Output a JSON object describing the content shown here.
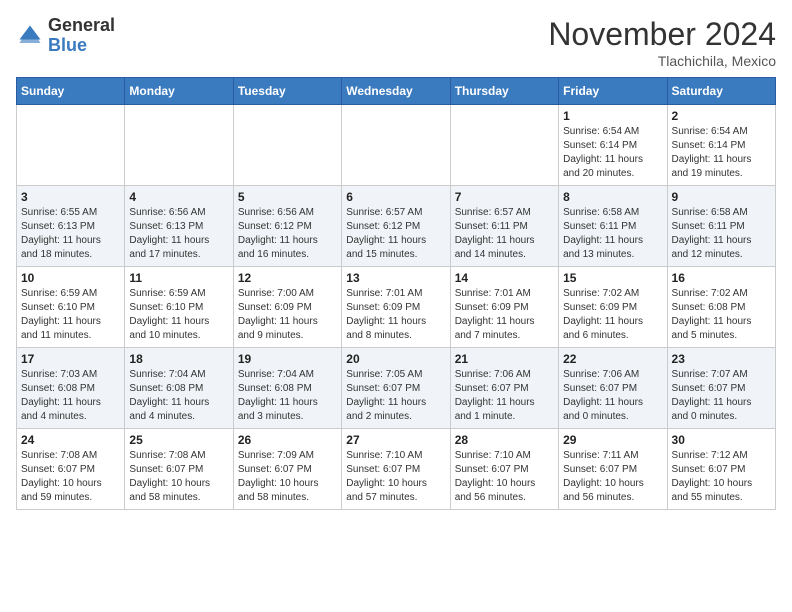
{
  "header": {
    "logo_general": "General",
    "logo_blue": "Blue",
    "month_title": "November 2024",
    "location": "Tlachichila, Mexico"
  },
  "weekdays": [
    "Sunday",
    "Monday",
    "Tuesday",
    "Wednesday",
    "Thursday",
    "Friday",
    "Saturday"
  ],
  "weeks": [
    [
      {
        "day": "",
        "info": ""
      },
      {
        "day": "",
        "info": ""
      },
      {
        "day": "",
        "info": ""
      },
      {
        "day": "",
        "info": ""
      },
      {
        "day": "",
        "info": ""
      },
      {
        "day": "1",
        "info": "Sunrise: 6:54 AM\nSunset: 6:14 PM\nDaylight: 11 hours\nand 20 minutes."
      },
      {
        "day": "2",
        "info": "Sunrise: 6:54 AM\nSunset: 6:14 PM\nDaylight: 11 hours\nand 19 minutes."
      }
    ],
    [
      {
        "day": "3",
        "info": "Sunrise: 6:55 AM\nSunset: 6:13 PM\nDaylight: 11 hours\nand 18 minutes."
      },
      {
        "day": "4",
        "info": "Sunrise: 6:56 AM\nSunset: 6:13 PM\nDaylight: 11 hours\nand 17 minutes."
      },
      {
        "day": "5",
        "info": "Sunrise: 6:56 AM\nSunset: 6:12 PM\nDaylight: 11 hours\nand 16 minutes."
      },
      {
        "day": "6",
        "info": "Sunrise: 6:57 AM\nSunset: 6:12 PM\nDaylight: 11 hours\nand 15 minutes."
      },
      {
        "day": "7",
        "info": "Sunrise: 6:57 AM\nSunset: 6:11 PM\nDaylight: 11 hours\nand 14 minutes."
      },
      {
        "day": "8",
        "info": "Sunrise: 6:58 AM\nSunset: 6:11 PM\nDaylight: 11 hours\nand 13 minutes."
      },
      {
        "day": "9",
        "info": "Sunrise: 6:58 AM\nSunset: 6:11 PM\nDaylight: 11 hours\nand 12 minutes."
      }
    ],
    [
      {
        "day": "10",
        "info": "Sunrise: 6:59 AM\nSunset: 6:10 PM\nDaylight: 11 hours\nand 11 minutes."
      },
      {
        "day": "11",
        "info": "Sunrise: 6:59 AM\nSunset: 6:10 PM\nDaylight: 11 hours\nand 10 minutes."
      },
      {
        "day": "12",
        "info": "Sunrise: 7:00 AM\nSunset: 6:09 PM\nDaylight: 11 hours\nand 9 minutes."
      },
      {
        "day": "13",
        "info": "Sunrise: 7:01 AM\nSunset: 6:09 PM\nDaylight: 11 hours\nand 8 minutes."
      },
      {
        "day": "14",
        "info": "Sunrise: 7:01 AM\nSunset: 6:09 PM\nDaylight: 11 hours\nand 7 minutes."
      },
      {
        "day": "15",
        "info": "Sunrise: 7:02 AM\nSunset: 6:09 PM\nDaylight: 11 hours\nand 6 minutes."
      },
      {
        "day": "16",
        "info": "Sunrise: 7:02 AM\nSunset: 6:08 PM\nDaylight: 11 hours\nand 5 minutes."
      }
    ],
    [
      {
        "day": "17",
        "info": "Sunrise: 7:03 AM\nSunset: 6:08 PM\nDaylight: 11 hours\nand 4 minutes."
      },
      {
        "day": "18",
        "info": "Sunrise: 7:04 AM\nSunset: 6:08 PM\nDaylight: 11 hours\nand 4 minutes."
      },
      {
        "day": "19",
        "info": "Sunrise: 7:04 AM\nSunset: 6:08 PM\nDaylight: 11 hours\nand 3 minutes."
      },
      {
        "day": "20",
        "info": "Sunrise: 7:05 AM\nSunset: 6:07 PM\nDaylight: 11 hours\nand 2 minutes."
      },
      {
        "day": "21",
        "info": "Sunrise: 7:06 AM\nSunset: 6:07 PM\nDaylight: 11 hours\nand 1 minute."
      },
      {
        "day": "22",
        "info": "Sunrise: 7:06 AM\nSunset: 6:07 PM\nDaylight: 11 hours\nand 0 minutes."
      },
      {
        "day": "23",
        "info": "Sunrise: 7:07 AM\nSunset: 6:07 PM\nDaylight: 11 hours\nand 0 minutes."
      }
    ],
    [
      {
        "day": "24",
        "info": "Sunrise: 7:08 AM\nSunset: 6:07 PM\nDaylight: 10 hours\nand 59 minutes."
      },
      {
        "day": "25",
        "info": "Sunrise: 7:08 AM\nSunset: 6:07 PM\nDaylight: 10 hours\nand 58 minutes."
      },
      {
        "day": "26",
        "info": "Sunrise: 7:09 AM\nSunset: 6:07 PM\nDaylight: 10 hours\nand 58 minutes."
      },
      {
        "day": "27",
        "info": "Sunrise: 7:10 AM\nSunset: 6:07 PM\nDaylight: 10 hours\nand 57 minutes."
      },
      {
        "day": "28",
        "info": "Sunrise: 7:10 AM\nSunset: 6:07 PM\nDaylight: 10 hours\nand 56 minutes."
      },
      {
        "day": "29",
        "info": "Sunrise: 7:11 AM\nSunset: 6:07 PM\nDaylight: 10 hours\nand 56 minutes."
      },
      {
        "day": "30",
        "info": "Sunrise: 7:12 AM\nSunset: 6:07 PM\nDaylight: 10 hours\nand 55 minutes."
      }
    ]
  ]
}
